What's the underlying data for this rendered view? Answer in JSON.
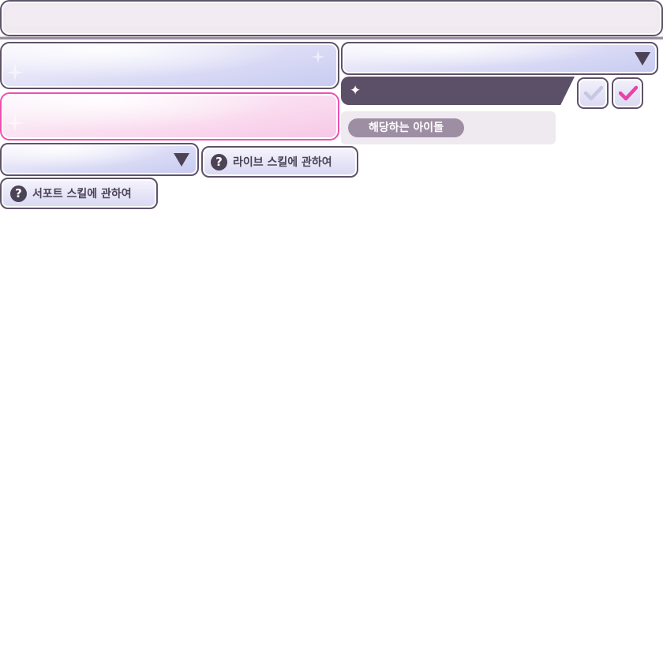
{
  "header": {
    "search_value": ""
  },
  "skill_panels": {
    "live_skill_text": "",
    "support_skill_text": ""
  },
  "filters": {
    "right_dropdown_value": "",
    "left_dropdown_value": ""
  },
  "matching": {
    "label": "해당하는 아이돌",
    "star_icon": "four-point-star"
  },
  "toggles": {
    "unchecked_icon": "check-icon",
    "checked_icon": "check-icon",
    "unchecked_color": "#c9c6e2",
    "checked_color": "#ee3fa8"
  },
  "help": {
    "live_skill_label": "라이브 스킬에 관하여",
    "support_skill_label": "서포트 스킬에 관하여",
    "icon_glyph": "?"
  },
  "colors": {
    "frame_border": "#5e5268",
    "pink_accent": "#ef4fb2",
    "dark_header": "#5c5068",
    "pill": "#9e8ea4"
  }
}
